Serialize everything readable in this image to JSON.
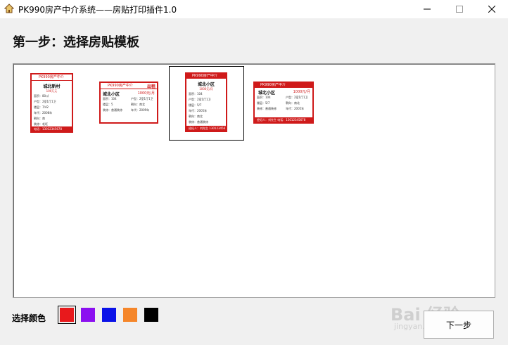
{
  "window": {
    "title": "PK990房产中介系统——房贴打印插件1.0",
    "controls": {
      "minimize": "—",
      "maximize": "☐",
      "close": "✕"
    }
  },
  "step_title": "第一步：选择房贴模板",
  "templates": [
    {
      "header": "PK990房产中介",
      "name": "城北新村",
      "price": "100万元",
      "rows": [
        "面积：80㎡",
        "户型：2室1厅1卫",
        "楼层：7/42",
        "年代：2008年",
        "朝向：南",
        "装修：毛坯"
      ],
      "footer": "电话：13012345678"
    },
    {
      "header": "PK990房产中介",
      "badge": "出租",
      "name": "城北小区",
      "price": "1000元/月",
      "rows": [
        "面积：104",
        "户型：2室1厅1卫",
        "楼层：5",
        "朝向：南北",
        "装修：普通装修",
        "年代：2009年"
      ]
    },
    {
      "header": "PK990房产中介",
      "name": "城北小区",
      "price": "1000元/月",
      "rows": [
        "面积：104",
        "户型：2室1厅1卫",
        "楼层：5/7",
        "年代：2005年",
        "朝向：南北",
        "装修：普通装修"
      ],
      "footer": "经纪人：刘先生  13012345678"
    },
    {
      "header": "PK990房产中介",
      "name": "城北小区",
      "price": "1000元/月",
      "rows": [
        "面积：104",
        "户型：2室1厅1卫",
        "楼层：5/7",
        "朝向：南北",
        "装修：普通装修",
        "年代：2005年"
      ],
      "footer": "经纪人：刘先生     电话：13012345678"
    }
  ],
  "color_label": "选择颜色",
  "colors": [
    "#e8191c",
    "#8b10f0",
    "#0a12e8",
    "#f5862a",
    "#000000"
  ],
  "selected_color_index": 0,
  "next_button": "下一步",
  "watermark": {
    "main": "Bai 经验",
    "sub": "jingyan.baidu.com"
  }
}
